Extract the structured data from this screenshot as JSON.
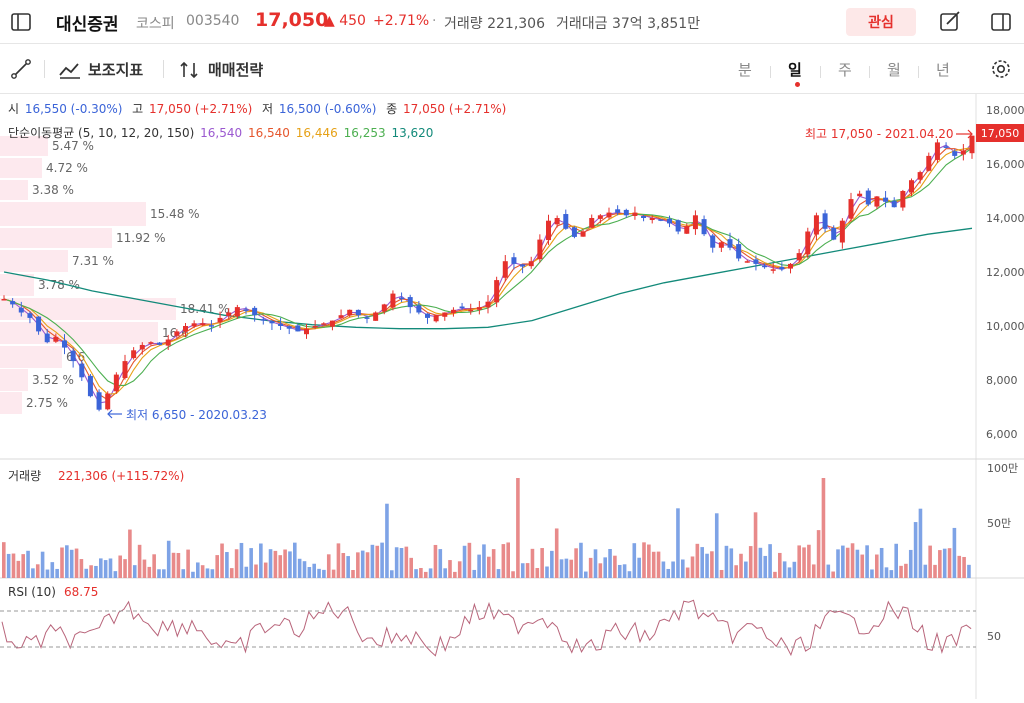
{
  "stock": {
    "name": "대신증권",
    "market": "코스피",
    "code": "003540",
    "price": "17,050",
    "change": "450",
    "change_pct": "+2.71%",
    "volume_label": "거래량",
    "volume": "221,306",
    "amount_label": "거래대금",
    "amount": "37억 3,851만",
    "favorite_label": "관심"
  },
  "toolbar": {
    "indicator_label": "보조지표",
    "strategy_label": "매매전략",
    "periods": [
      "분",
      "일",
      "주",
      "월",
      "년"
    ],
    "active_period": "일"
  },
  "ohlc": {
    "open_label": "시",
    "open": "16,550 (-0.30%)",
    "high_label": "고",
    "high": "17,050 (+2.71%)",
    "low_label": "저",
    "low": "16,500 (-0.60%)",
    "close_label": "종",
    "close": "17,050 (+2.71%)"
  },
  "moving_average": {
    "label": "단순이동평균 (5, 10, 12, 20, 150)",
    "values": [
      {
        "value": "16,540",
        "color": "#9b59d0"
      },
      {
        "value": "16,540",
        "color": "#e5562c"
      },
      {
        "value": "16,446",
        "color": "#e6a117"
      },
      {
        "value": "16,253",
        "color": "#4caf50"
      },
      {
        "value": "13,620",
        "color": "#138a7a"
      }
    ]
  },
  "price_axis": {
    "ticks": [
      "18,000",
      "16,000",
      "14,000",
      "12,000",
      "10,000",
      "8,000",
      "6,000"
    ],
    "current": "17,050"
  },
  "annotations": {
    "high": "최고 17,050 - 2021.04.20",
    "low": "최저 6,650 - 2020.03.23"
  },
  "volume_profile": [
    "5.47 %",
    "4.72 %",
    "3.38 %",
    "15.48 %",
    "11.92 %",
    "7.31 %",
    "3.78 %",
    "18.41 %",
    "16.6",
    "6.6",
    "3.52 %",
    "2.75 %"
  ],
  "volume_panel": {
    "label": "거래량",
    "value": "221,306 (+115.72%)",
    "ticks": [
      "100만",
      "50만"
    ]
  },
  "rsi_panel": {
    "label": "RSI (10)",
    "value": "68.75",
    "tick": "50"
  },
  "chart_data": {
    "type": "candlestick",
    "y_range": [
      6000,
      18000
    ],
    "close_path": [
      11000,
      10800,
      10500,
      10300,
      9800,
      9400,
      9600,
      9200,
      8700,
      8100,
      7400,
      6900,
      7500,
      8200,
      8700,
      9100,
      9300,
      9400,
      9300,
      9500,
      9800,
      10000,
      10100,
      10100,
      10000,
      10300,
      10500,
      10700,
      10600,
      10400,
      10200,
      10100,
      10000,
      9900,
      9800,
      9900,
      10000,
      10100,
      10200,
      10400,
      10600,
      10400,
      10300,
      10500,
      10800,
      11200,
      11000,
      10700,
      10500,
      10300,
      10400,
      10500,
      10600,
      10700,
      10600,
      10700,
      10900,
      11700,
      12400,
      12300,
      12200,
      12400,
      13200,
      13900,
      14000,
      13600,
      13300,
      13500,
      14000,
      14100,
      14200,
      14200,
      14100,
      14200,
      14000,
      14000,
      13900,
      13800,
      13500,
      13700,
      14100,
      13400,
      12900,
      13100,
      12900,
      12500,
      12400,
      12300,
      12200,
      12100,
      12100,
      12300,
      12700,
      13500,
      14100,
      13600,
      13200,
      13900,
      14700,
      14900,
      14500,
      14800,
      14600,
      14400,
      15000,
      15400,
      15700,
      16300,
      16800,
      16600,
      16300,
      16500,
      17050
    ]
  }
}
